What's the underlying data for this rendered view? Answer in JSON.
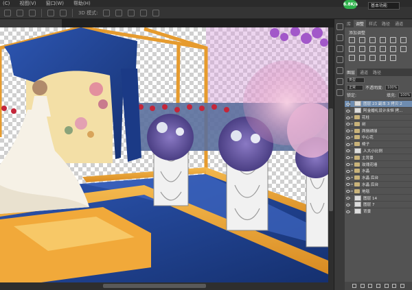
{
  "menubar": {
    "items": [
      "(C)",
      "视图(V)",
      "窗口(W)",
      "帮助(H)"
    ]
  },
  "options_bar": {
    "mode_label": "3D 模式:"
  },
  "network_badge": "6.8K/s",
  "workspace": {
    "selected": "基本功能"
  },
  "adjustments_panel": {
    "tabs": [
      "库",
      "调整",
      "样式",
      "路径",
      "通道"
    ],
    "title": "添加调整"
  },
  "layers_panel": {
    "tabs": [
      "图层",
      "通道",
      "路径"
    ],
    "filter_kind": "类型",
    "blend_mode": "正常",
    "opacity_label": "不透明度:",
    "opacity_value": "100%",
    "lock_label": "锁定:",
    "fill_label": "填充:",
    "fill_value": "100%",
    "layers": [
      {
        "name": "图层 23 副本 3 拷贝 2",
        "kind": "image",
        "selected": true
      },
      {
        "name": "阿金婚礼设计永恒 拷...",
        "kind": "image"
      },
      {
        "name": "花柱",
        "kind": "group"
      },
      {
        "name": "树",
        "kind": "group"
      },
      {
        "name": "两侧绣球",
        "kind": "group"
      },
      {
        "name": "中心花",
        "kind": "group"
      },
      {
        "name": "椅子",
        "kind": "group"
      },
      {
        "name": "人大小比例",
        "kind": "image"
      },
      {
        "name": "主背景",
        "kind": "group"
      },
      {
        "name": "玫瑰花墙",
        "kind": "group"
      },
      {
        "name": "水晶",
        "kind": "group"
      },
      {
        "name": "水晶 后台",
        "kind": "group"
      },
      {
        "name": "水晶 后台",
        "kind": "group"
      },
      {
        "name": "地毯",
        "kind": "group"
      },
      {
        "name": "图层 14",
        "kind": "image"
      },
      {
        "name": "图层 7",
        "kind": "image"
      },
      {
        "name": "背景",
        "kind": "image"
      }
    ]
  },
  "colors": {
    "ui_dark": "#282828",
    "panel_gray": "#535353",
    "selection_blue": "#6e8cb0",
    "stage_orange": "#e9a43a",
    "carpet_blue": "#1f3f8f",
    "green_badge": "#2fb24c"
  }
}
